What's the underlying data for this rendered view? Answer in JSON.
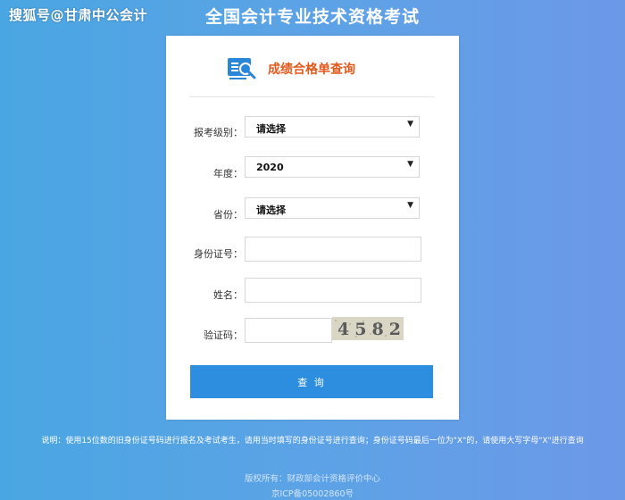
{
  "watermark": "搜狐号@甘肃中公会计",
  "page_title": "全国会计专业技术资格考试",
  "card": {
    "icon": "score-search-icon",
    "title": "成绩合格单查询",
    "fields": {
      "level": {
        "label": "报考级别：",
        "value": "请选择"
      },
      "year": {
        "label": "年度：",
        "value": "2020"
      },
      "province": {
        "label": "省份：",
        "value": "请选择"
      },
      "id_number": {
        "label": "身份证号：",
        "value": "",
        "placeholder": ""
      },
      "name": {
        "label": "姓名：",
        "value": "",
        "placeholder": ""
      },
      "captcha": {
        "label": "验证码：",
        "value": "",
        "placeholder": "",
        "image_text": "4582"
      }
    },
    "submit_label": "查 询"
  },
  "note": "说明：使用15位数的旧身份证号码进行报名及考试考生，请用当时填写的身份证号进行查询；身份证号码最后一位为\"X\"的，请使用大写字母\"X\"进行查询",
  "footer": {
    "copyright": "版权所有：财政部会计资格评价中心",
    "icp": "京ICP备05002860号"
  },
  "colors": {
    "accent": "#2d8ee0",
    "title_orange": "#e05a1e",
    "background": "#5ea2e6"
  }
}
